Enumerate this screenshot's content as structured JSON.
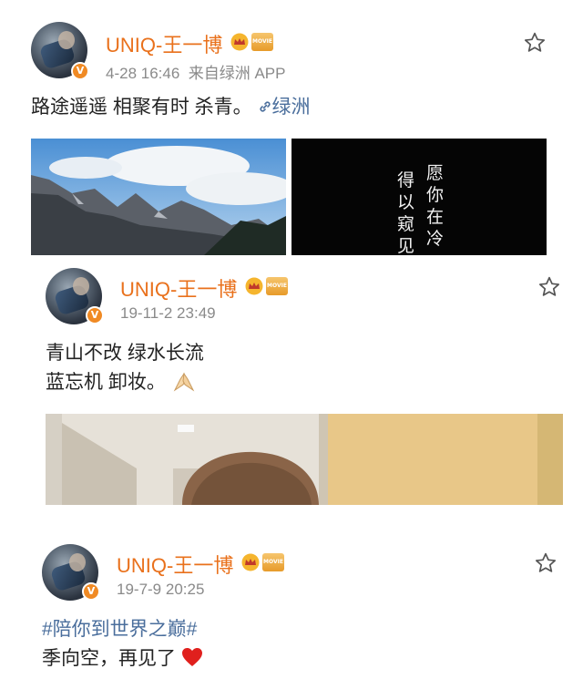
{
  "posts": [
    {
      "username": "UNIQ-王一博",
      "meta_time": "4-28 16:46",
      "meta_source": "来自绿洲 APP",
      "text": "路途遥遥 相聚有时 杀青。",
      "link_text": "绿洲",
      "movie_badge": "MOVIE",
      "verified": "V",
      "poem_col1": "愿你在冷",
      "poem_col2": "得以窥见"
    },
    {
      "username": "UNIQ-王一博",
      "meta_time": "19-11-2 23:49",
      "line1": "青山不改 绿水长流",
      "line2": "蓝忘机 卸妆。",
      "movie_badge": "MOVIE",
      "verified": "V"
    },
    {
      "username": "UNIQ-王一博",
      "meta_time": "19-7-9 20:25",
      "hashtag": "#陪你到世界之巅#",
      "line2": "季向空，再见了",
      "movie_badge": "MOVIE",
      "verified": "V"
    }
  ],
  "colors": {
    "username": "#e9711c",
    "link": "#4a6e9c",
    "meta": "#8a8a8a",
    "heart": "#e0201d"
  },
  "icons": [
    "star-icon",
    "crown-icon",
    "link-icon",
    "praying-hands-icon",
    "heart-icon",
    "verified-icon"
  ]
}
